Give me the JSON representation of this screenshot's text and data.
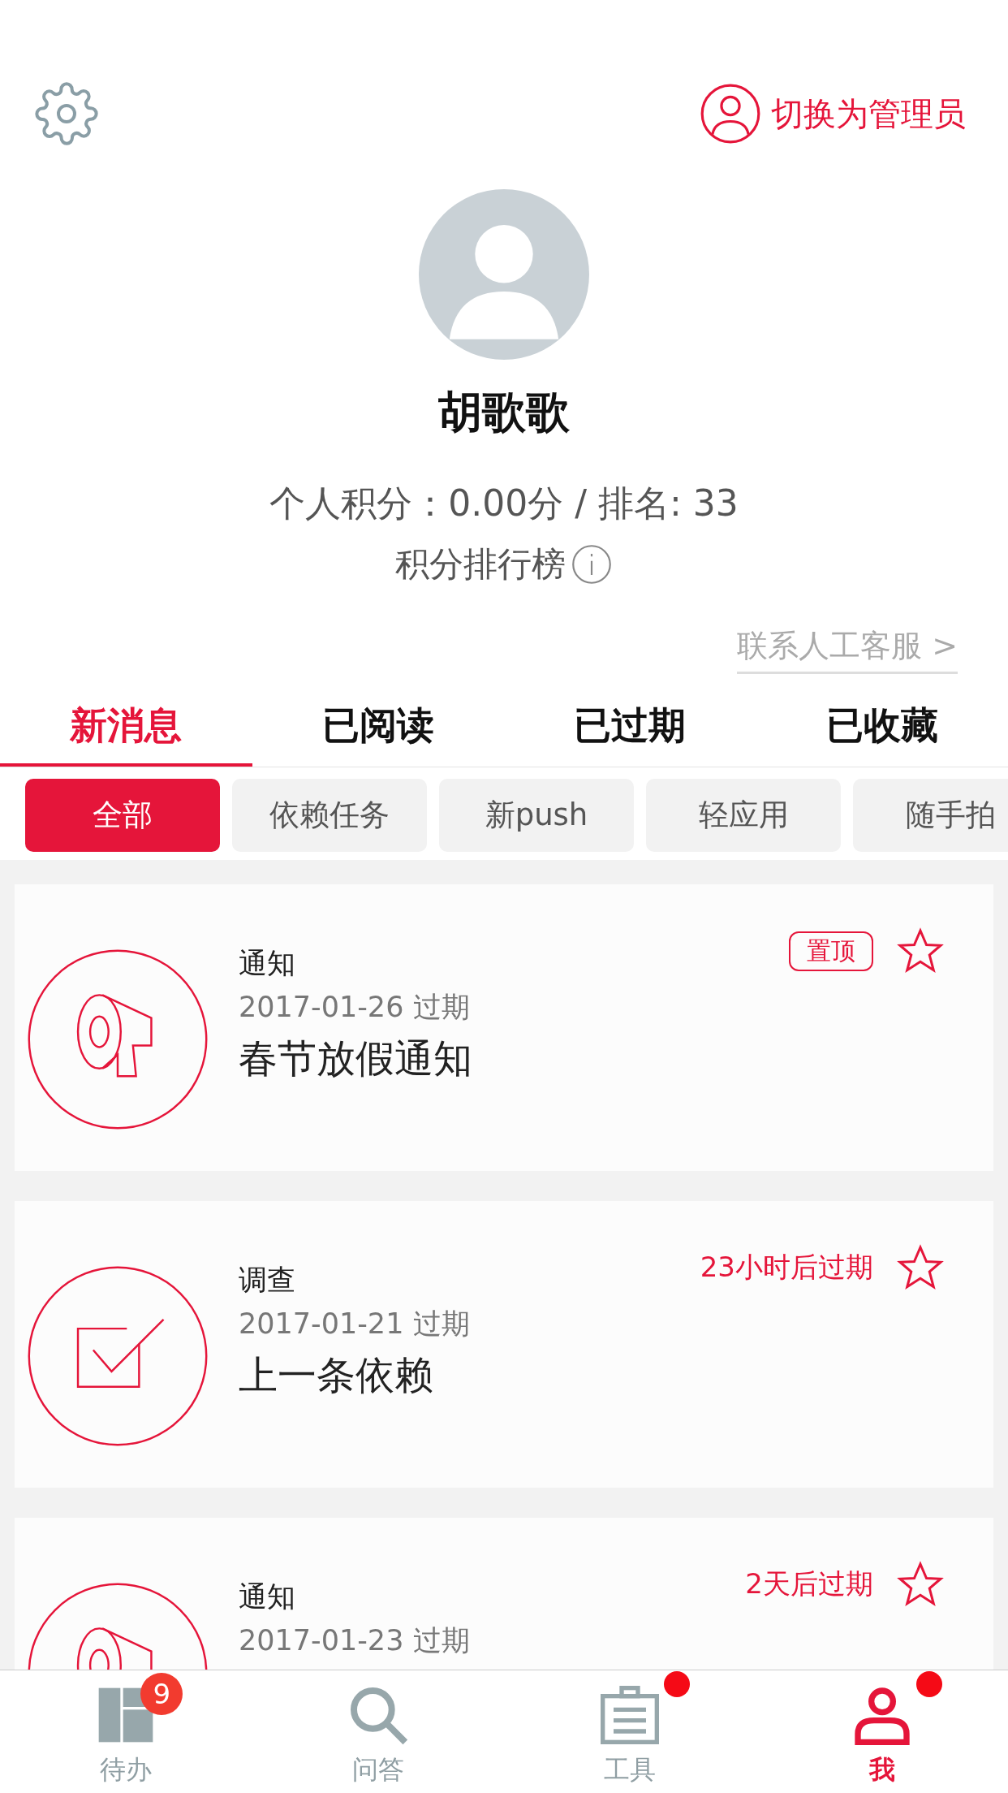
{
  "top_bar": {
    "switch_button": "切换为管理员"
  },
  "profile": {
    "name": "胡歌歌",
    "score_line": "个人积分：0.00分 / 排名: 33",
    "leaderboard_link": "积分排行榜",
    "contact_link": "联系人工客服 >"
  },
  "tabs": [
    {
      "label": "新消息",
      "selected": true
    },
    {
      "label": "已阅读",
      "selected": false
    },
    {
      "label": "已过期",
      "selected": false
    },
    {
      "label": "已收藏",
      "selected": false
    }
  ],
  "filters": [
    {
      "label": "全部",
      "selected": true
    },
    {
      "label": "依赖任务",
      "selected": false
    },
    {
      "label": "新push",
      "selected": false
    },
    {
      "label": "轻应用",
      "selected": false
    },
    {
      "label": "随手拍",
      "selected": false
    }
  ],
  "messages": [
    {
      "kind": "notice",
      "type": "通知",
      "date": "2017-01-26 过期",
      "title": "春节放假通知",
      "pinned_label": "置顶",
      "starred": false
    },
    {
      "kind": "survey",
      "type": "调查",
      "date": "2017-01-21 过期",
      "title": "上一条依赖",
      "expiry": "23小时后过期",
      "starred": false
    },
    {
      "kind": "notice",
      "type": "通知",
      "date": "2017-01-23 过期",
      "expiry": "2天后过期",
      "starred": false
    }
  ],
  "bottom_nav": [
    {
      "label": "待办",
      "badge": "9",
      "dot": false,
      "selected": false
    },
    {
      "label": "问答",
      "dot": false,
      "selected": false
    },
    {
      "label": "工具",
      "dot": true,
      "selected": false
    },
    {
      "label": "我",
      "dot": true,
      "selected": true
    }
  ]
}
